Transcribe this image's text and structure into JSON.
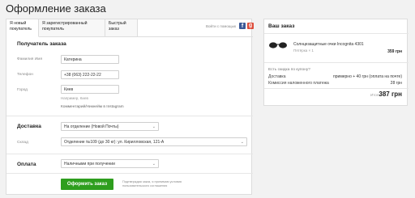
{
  "page": {
    "title": "Оформление заказа"
  },
  "tabs": [
    {
      "label": "Я новый покупатель",
      "active": true
    },
    {
      "label": "Я зарегистрированный покупатель",
      "active": false
    },
    {
      "label": "Быстрый заказ",
      "active": false
    }
  ],
  "social": {
    "label": "Войти с помощью",
    "icons": [
      "facebook-icon",
      "google-plus-icon"
    ],
    "colors": {
      "facebook": "#3b5998",
      "google": "#dd4b39"
    }
  },
  "receiver": {
    "title": "Получатель заказа",
    "fields": [
      {
        "label": "Фамилия Имя",
        "value": "Катерина"
      },
      {
        "label": "Телефон",
        "value": "+38 (063) 222-22-22"
      },
      {
        "label": "Город",
        "value": "Киев",
        "hint": "Например, Киев"
      }
    ],
    "comment_link": "Комментарий/Никнейм в Instagram"
  },
  "delivery": {
    "title": "Доставка",
    "method": "На отделение (Новой Почты)",
    "warehouse_label": "Склад",
    "warehouse": "Отделение №109 (до 30 кг): ул. Кирилловская, 121-А"
  },
  "payment": {
    "title": "Оплата",
    "method": "Наличными при получении"
  },
  "submit": {
    "label": "Оформить заказ",
    "agree_text": "Подтверждая заказ, я принимаю условия пользовательского соглашения",
    "color": "#2e9e1e"
  },
  "summary": {
    "title": "Ваш заказ",
    "product": {
      "name": "Солнцезащитные очки Incognita 4301",
      "qty": "Пятёрка × 1",
      "price": "359 грн"
    },
    "coupon": "Есть скидка по купону?",
    "rows": [
      {
        "label": "Доставка",
        "value": "примерно + 40 грн (оплата на почте)"
      },
      {
        "label": "Комиссия наложенного платежа",
        "value": "28 грн"
      }
    ],
    "total_label": "Итого:",
    "total": "387 грн"
  }
}
